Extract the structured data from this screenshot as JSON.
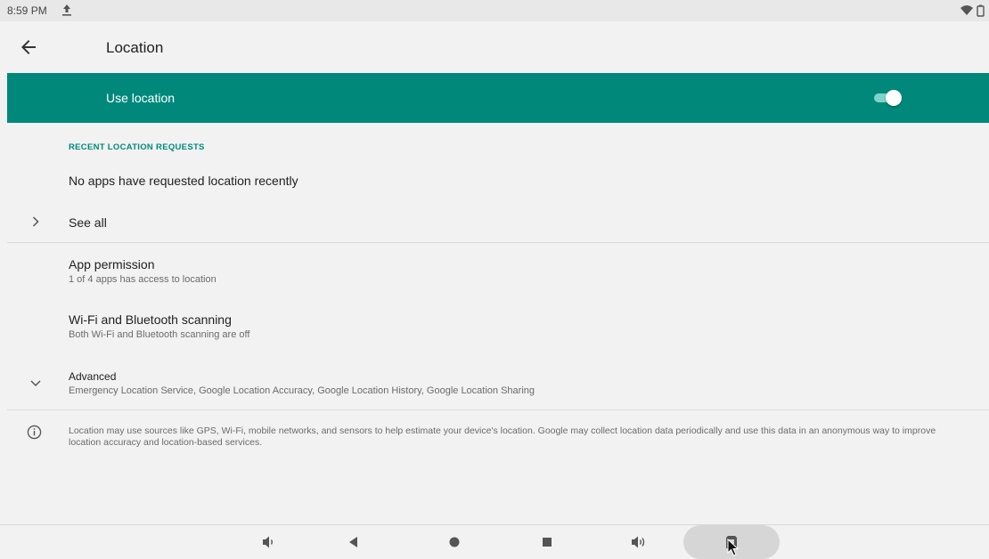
{
  "status_bar": {
    "time": "8:59 PM"
  },
  "app_bar": {
    "title": "Location"
  },
  "master_switch": {
    "label": "Use location",
    "enabled": true
  },
  "recent_requests": {
    "header": "RECENT LOCATION REQUESTS",
    "empty_text": "No apps have requested location recently",
    "see_all_label": "See all"
  },
  "settings": [
    {
      "title": "App permission",
      "subtitle": "1 of 4 apps has access to location"
    },
    {
      "title": "Wi-Fi and Bluetooth scanning",
      "subtitle": "Both Wi-Fi and Bluetooth scanning are off"
    },
    {
      "title": "Advanced",
      "subtitle": "Emergency Location Service, Google Location Accuracy, Google Location History, Google Location Sharing"
    }
  ],
  "footer": {
    "text": "Location may use sources like GPS, Wi-Fi, mobile networks, and sensors to help estimate your device's location. Google may collect location data periodically and use this data in an anonymous way to improve location accuracy and location-based services."
  },
  "nav_buttons": [
    "volume-down-icon",
    "back-icon",
    "home-icon",
    "recents-icon",
    "volume-up-icon",
    "screenshot-icon"
  ],
  "colors": {
    "accent": "#00897b",
    "background": "#f2f2f2",
    "toggle_track": "#7ed3c8"
  }
}
